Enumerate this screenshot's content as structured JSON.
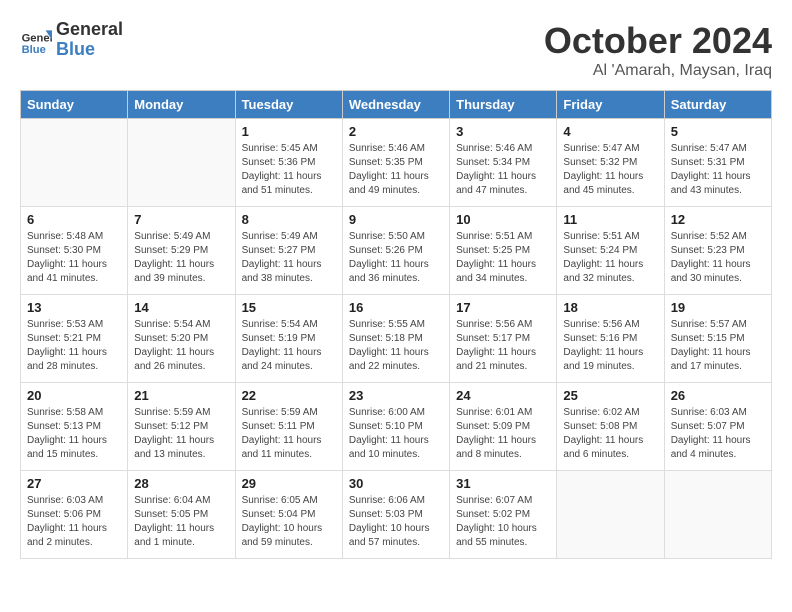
{
  "logo": {
    "line1": "General",
    "line2": "Blue"
  },
  "title": "October 2024",
  "location": "Al 'Amarah, Maysan, Iraq",
  "days_of_week": [
    "Sunday",
    "Monday",
    "Tuesday",
    "Wednesday",
    "Thursday",
    "Friday",
    "Saturday"
  ],
  "weeks": [
    [
      {
        "num": "",
        "detail": ""
      },
      {
        "num": "",
        "detail": ""
      },
      {
        "num": "1",
        "detail": "Sunrise: 5:45 AM\nSunset: 5:36 PM\nDaylight: 11 hours\nand 51 minutes."
      },
      {
        "num": "2",
        "detail": "Sunrise: 5:46 AM\nSunset: 5:35 PM\nDaylight: 11 hours\nand 49 minutes."
      },
      {
        "num": "3",
        "detail": "Sunrise: 5:46 AM\nSunset: 5:34 PM\nDaylight: 11 hours\nand 47 minutes."
      },
      {
        "num": "4",
        "detail": "Sunrise: 5:47 AM\nSunset: 5:32 PM\nDaylight: 11 hours\nand 45 minutes."
      },
      {
        "num": "5",
        "detail": "Sunrise: 5:47 AM\nSunset: 5:31 PM\nDaylight: 11 hours\nand 43 minutes."
      }
    ],
    [
      {
        "num": "6",
        "detail": "Sunrise: 5:48 AM\nSunset: 5:30 PM\nDaylight: 11 hours\nand 41 minutes."
      },
      {
        "num": "7",
        "detail": "Sunrise: 5:49 AM\nSunset: 5:29 PM\nDaylight: 11 hours\nand 39 minutes."
      },
      {
        "num": "8",
        "detail": "Sunrise: 5:49 AM\nSunset: 5:27 PM\nDaylight: 11 hours\nand 38 minutes."
      },
      {
        "num": "9",
        "detail": "Sunrise: 5:50 AM\nSunset: 5:26 PM\nDaylight: 11 hours\nand 36 minutes."
      },
      {
        "num": "10",
        "detail": "Sunrise: 5:51 AM\nSunset: 5:25 PM\nDaylight: 11 hours\nand 34 minutes."
      },
      {
        "num": "11",
        "detail": "Sunrise: 5:51 AM\nSunset: 5:24 PM\nDaylight: 11 hours\nand 32 minutes."
      },
      {
        "num": "12",
        "detail": "Sunrise: 5:52 AM\nSunset: 5:23 PM\nDaylight: 11 hours\nand 30 minutes."
      }
    ],
    [
      {
        "num": "13",
        "detail": "Sunrise: 5:53 AM\nSunset: 5:21 PM\nDaylight: 11 hours\nand 28 minutes."
      },
      {
        "num": "14",
        "detail": "Sunrise: 5:54 AM\nSunset: 5:20 PM\nDaylight: 11 hours\nand 26 minutes."
      },
      {
        "num": "15",
        "detail": "Sunrise: 5:54 AM\nSunset: 5:19 PM\nDaylight: 11 hours\nand 24 minutes."
      },
      {
        "num": "16",
        "detail": "Sunrise: 5:55 AM\nSunset: 5:18 PM\nDaylight: 11 hours\nand 22 minutes."
      },
      {
        "num": "17",
        "detail": "Sunrise: 5:56 AM\nSunset: 5:17 PM\nDaylight: 11 hours\nand 21 minutes."
      },
      {
        "num": "18",
        "detail": "Sunrise: 5:56 AM\nSunset: 5:16 PM\nDaylight: 11 hours\nand 19 minutes."
      },
      {
        "num": "19",
        "detail": "Sunrise: 5:57 AM\nSunset: 5:15 PM\nDaylight: 11 hours\nand 17 minutes."
      }
    ],
    [
      {
        "num": "20",
        "detail": "Sunrise: 5:58 AM\nSunset: 5:13 PM\nDaylight: 11 hours\nand 15 minutes."
      },
      {
        "num": "21",
        "detail": "Sunrise: 5:59 AM\nSunset: 5:12 PM\nDaylight: 11 hours\nand 13 minutes."
      },
      {
        "num": "22",
        "detail": "Sunrise: 5:59 AM\nSunset: 5:11 PM\nDaylight: 11 hours\nand 11 minutes."
      },
      {
        "num": "23",
        "detail": "Sunrise: 6:00 AM\nSunset: 5:10 PM\nDaylight: 11 hours\nand 10 minutes."
      },
      {
        "num": "24",
        "detail": "Sunrise: 6:01 AM\nSunset: 5:09 PM\nDaylight: 11 hours\nand 8 minutes."
      },
      {
        "num": "25",
        "detail": "Sunrise: 6:02 AM\nSunset: 5:08 PM\nDaylight: 11 hours\nand 6 minutes."
      },
      {
        "num": "26",
        "detail": "Sunrise: 6:03 AM\nSunset: 5:07 PM\nDaylight: 11 hours\nand 4 minutes."
      }
    ],
    [
      {
        "num": "27",
        "detail": "Sunrise: 6:03 AM\nSunset: 5:06 PM\nDaylight: 11 hours\nand 2 minutes."
      },
      {
        "num": "28",
        "detail": "Sunrise: 6:04 AM\nSunset: 5:05 PM\nDaylight: 11 hours\nand 1 minute."
      },
      {
        "num": "29",
        "detail": "Sunrise: 6:05 AM\nSunset: 5:04 PM\nDaylight: 10 hours\nand 59 minutes."
      },
      {
        "num": "30",
        "detail": "Sunrise: 6:06 AM\nSunset: 5:03 PM\nDaylight: 10 hours\nand 57 minutes."
      },
      {
        "num": "31",
        "detail": "Sunrise: 6:07 AM\nSunset: 5:02 PM\nDaylight: 10 hours\nand 55 minutes."
      },
      {
        "num": "",
        "detail": ""
      },
      {
        "num": "",
        "detail": ""
      }
    ]
  ]
}
